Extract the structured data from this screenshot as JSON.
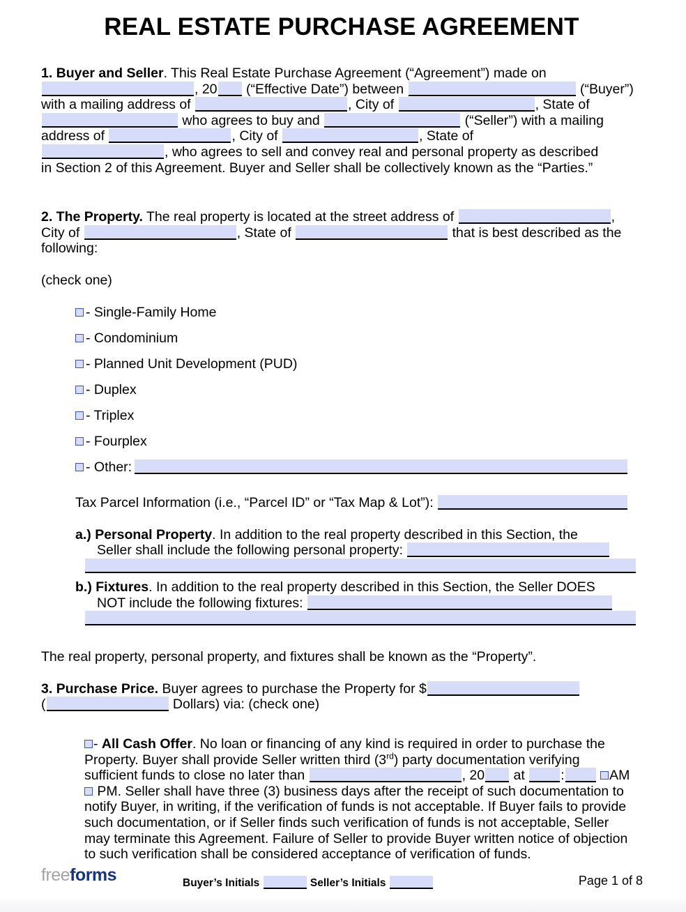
{
  "document": {
    "title": "REAL ESTATE PURCHASE AGREEMENT"
  },
  "colors": {
    "field_fill": "#d7dcf8",
    "field_rule": "#000000",
    "checkbox_border": "#3b54a8",
    "logo_free": "#a3a3a3",
    "logo_forms": "#17357e"
  },
  "section1": {
    "heading": "1. Buyer and Seller",
    "t1": ". This Real Estate Purchase Agreement (“Agreement”) made on",
    "t2": ", 20",
    "t3": "(“Effective Date”) between",
    "t4": "(“Buyer”)",
    "t5": "with a mailing address of",
    "t6": ", City of",
    "t7": ", State of",
    "t8": "who agrees to buy and",
    "t9": "(“Seller”) with a mailing",
    "t10": "address of",
    "t11": ", City of",
    "t12": ", State of",
    "t13": ", who agrees to sell and convey real and personal property as described",
    "t14": "in Section 2 of this Agreement. Buyer and Seller shall be collectively known as the “Parties.”"
  },
  "section2": {
    "heading": "2. The Property.",
    "t1": " The real property is located at the street address of",
    "t2": ",",
    "t3": "City of",
    "t4": ", State of",
    "t5": "that is best described as the",
    "t6": "following:",
    "check_one": "(check one)",
    "options": [
      {
        "label": "- Single-Family Home"
      },
      {
        "label": "- Condominium"
      },
      {
        "label": "- Planned Unit Development (PUD)"
      },
      {
        "label": "- Duplex"
      },
      {
        "label": "- Triplex"
      },
      {
        "label": "- Fourplex"
      },
      {
        "label": "- Other:"
      }
    ],
    "tax_parcel_label": "Tax Parcel Information (i.e., “Parcel ID” or “Tax Map & Lot”):",
    "item_a": {
      "marker": "a.)",
      "heading": "Personal Property",
      "t1": ". In addition to the real property described in this Section, the",
      "t2": "Seller shall include the following personal property:"
    },
    "item_b": {
      "marker": "b.)",
      "heading": "Fixtures",
      "t1": ". In addition to the real property described in this Section, the Seller DOES",
      "t2": "NOT include the following fixtures:"
    },
    "closing": "The real property, personal property, and fixtures shall be known as the “Property”."
  },
  "section3": {
    "heading": "3. Purchase Price.",
    "t1": " Buyer agrees to purchase the Property for $",
    "t2": "(",
    "t3": "Dollars) via: (check one)",
    "cash_offer": {
      "dash": "- ",
      "heading": "All Cash Offer",
      "t1": ". No loan or financing of any kind is required in order to purchase the",
      "t2": "Property. Buyer shall provide Seller written third (3",
      "t2sup": "rd",
      "t2b": ") party documentation verifying",
      "t3": "sufficient funds to close no later than",
      "t4": ", 20",
      "t5": "at",
      "t6": ":",
      "t7": "AM",
      "t8": "PM. Seller shall have three (3) business days after the receipt of such documentation to",
      "t9": "notify Buyer, in writing, if the verification of funds is not acceptable. If Buyer fails to provide",
      "t10": "such documentation, or if Seller finds such verification of funds is not acceptable, Seller",
      "t11": "may terminate this Agreement. Failure of Seller to provide Buyer written notice of objection",
      "t12": "to such verification shall be considered acceptance of verification of funds."
    }
  },
  "footer": {
    "logo_free": "free",
    "logo_forms": "forms",
    "buyer_initials_label": "Buyer’s Initials",
    "seller_initials_label": "Seller’s Initials",
    "page_label": "Page 1 of 8"
  }
}
